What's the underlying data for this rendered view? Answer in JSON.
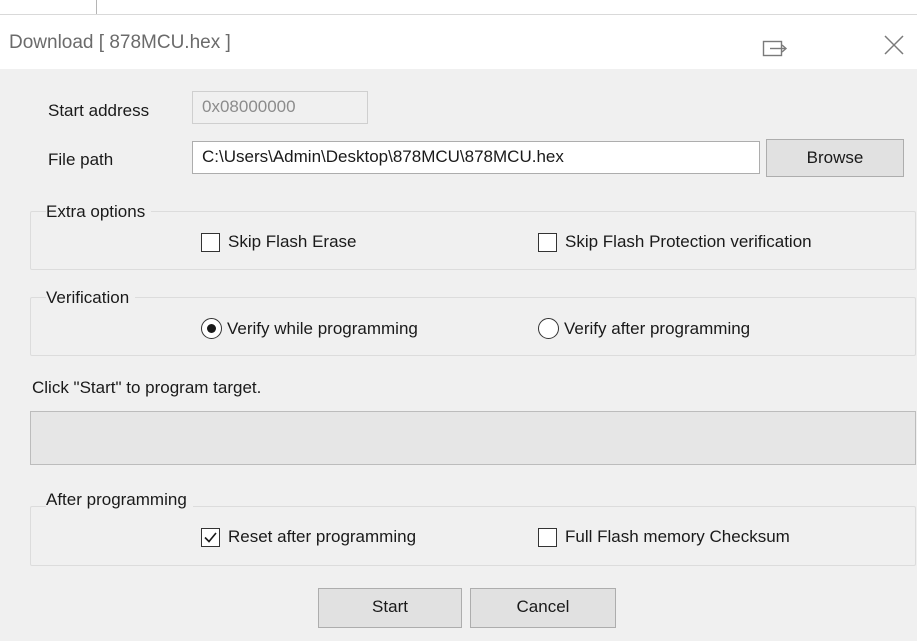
{
  "window": {
    "title": "Download [ 878MCU.hex ]",
    "restore_icon": "restore-icon",
    "close_icon": "close-icon"
  },
  "start_address": {
    "label": "Start address",
    "value": "0x08000000",
    "enabled": false
  },
  "file_path": {
    "label": "File path",
    "value": "C:\\Users\\Admin\\Desktop\\878MCU\\878MCU.hex",
    "browse_label": "Browse"
  },
  "extra_options": {
    "title": "Extra options",
    "skip_flash_erase": {
      "label": "Skip Flash Erase",
      "checked": false
    },
    "skip_flash_protection": {
      "label": "Skip Flash Protection verification",
      "checked": false
    }
  },
  "verification": {
    "title": "Verification",
    "options": [
      {
        "label": "Verify while programming",
        "selected": true
      },
      {
        "label": "Verify after programming",
        "selected": false
      }
    ]
  },
  "status": {
    "message": "Click \"Start\" to program target.",
    "progress": 0
  },
  "after_programming": {
    "title": "After programming",
    "reset_after_programming": {
      "label": "Reset after programming",
      "checked": true
    },
    "full_flash_checksum": {
      "label": "Full Flash memory Checksum",
      "checked": false
    }
  },
  "buttons": {
    "start_label": "Start",
    "cancel_label": "Cancel"
  },
  "colors": {
    "background": "#f0f0f0",
    "title_text": "#6b6b6b",
    "disabled_text": "#8c8c8c",
    "progress_fill": "#06b025"
  }
}
